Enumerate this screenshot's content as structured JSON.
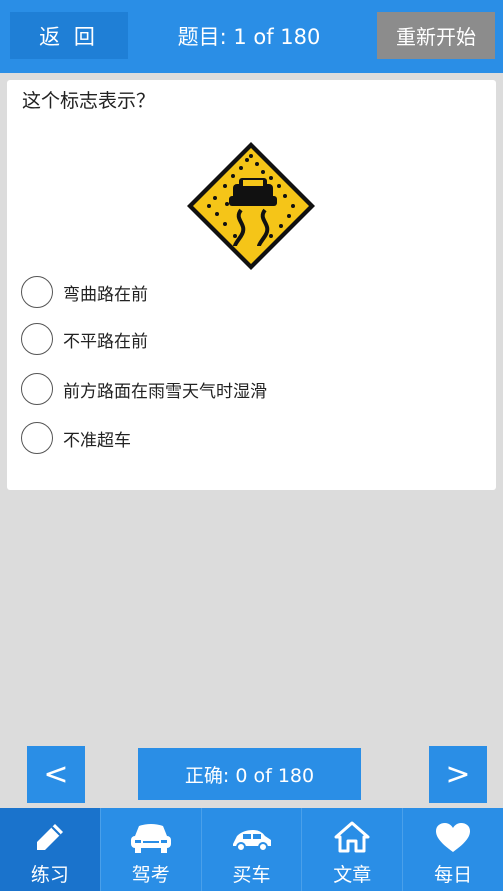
{
  "header": {
    "back_label": "返 回",
    "title": "题目: 1 of 180",
    "restart_label": "重新开始"
  },
  "question": {
    "text": "这个标志表示？",
    "options": [
      "弯曲路在前",
      "不平路在前",
      "前方路面在雨雪天气时湿滑",
      "不准超车"
    ]
  },
  "footer": {
    "prev_label": "<",
    "next_label": ">",
    "score": "正确: 0 of 180"
  },
  "tabs": [
    {
      "label": "练习",
      "icon": "pencil-icon"
    },
    {
      "label": "驾考",
      "icon": "car-front-icon"
    },
    {
      "label": "买车",
      "icon": "car-side-icon"
    },
    {
      "label": "文章",
      "icon": "home-icon"
    },
    {
      "label": "每日",
      "icon": "heart-icon"
    }
  ],
  "colors": {
    "primary": "#2a8ee6",
    "active_tab": "#1a73cc",
    "restart": "#8c8c8c",
    "background": "#dcdcdc",
    "sign_yellow": "#f5c518"
  }
}
